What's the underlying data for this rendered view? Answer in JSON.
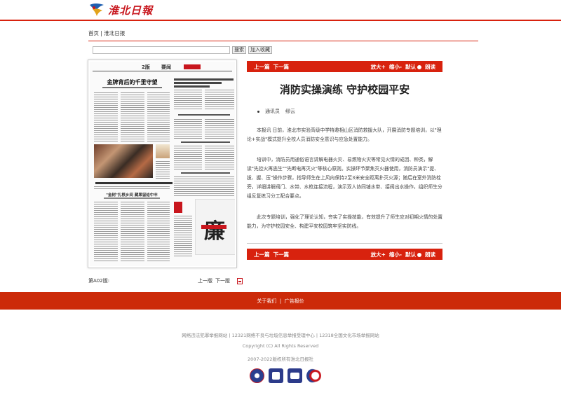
{
  "site": {
    "logo_text": "淮北日報"
  },
  "breadcrumb": {
    "home": "首页",
    "separator": "|",
    "current": "淮北日报"
  },
  "search": {
    "placeholder": "",
    "search_button": "搜索",
    "favorite_button": "加入收藏"
  },
  "paper": {
    "page_number": "2版",
    "section": "要闻",
    "headline_main": "金牌背后的千里守望",
    "headline_bottom": "\"金树\"扎根乡间  藏果留给中丰",
    "poster_char": "廉"
  },
  "page_info": {
    "label": "第A02版:",
    "prev": "上一版",
    "next": "下一版",
    "pdf_icon": "pdf-icon"
  },
  "toolbar": {
    "prev": "上一篇",
    "next": "下一篇",
    "zoom_in": "放大+",
    "zoom_out": "缩小-",
    "default": "默认",
    "read_aloud": "朗读"
  },
  "article": {
    "title": "消防实操演练    守护校园平安",
    "reporter": "通讯员",
    "author": "缪云",
    "paragraphs": [
      "本报讯   日前，淮北市实验高级中学特邀相山区消防救援大队，开展消防专题培训，以\"理论+实战\"模式提升全校人员消防安全意识与应急处置能力。",
      "培训中，消防员用通俗语言讲解电器火灾、易燃物火灾等常见火情的成因、种类，解读\"先控火再逃生\"\"先断电再灭火\"等核心原则。实操环节聚焦灭火器使用，消防员演示\"提、拔、握、压\"操作步骤，指导师生在上风向保持2至3米安全距离扑灭火源；随后在室外消防栓旁，详细讲解阀门、水带、水枪连接流程，演示双人协同铺水带、接阀出水操作，组织师生分组反复练习分工配合要点。",
      "此次专题培训，强化了理论认知，夯实了实操技能，有效提升了师生应对初期火情的处置能力，为守护校园安全、构建平安校园筑牢坚实防线。"
    ]
  },
  "footer": {
    "about": "关于我们",
    "separator": "|",
    "ads": "广告报价",
    "report_line": "网络违法犯罪举报网站  |  12321网络不良与垃圾信息举报受理中心  |  12318全国文化市场举报网站",
    "copyright": "Copyright (C) All Rights Reserved",
    "owner": "2007-2022版权所有淮北日报社"
  },
  "colors": {
    "accent": "#d8220e",
    "footer_band": "#cc2a09",
    "brand": "#c8161d"
  }
}
